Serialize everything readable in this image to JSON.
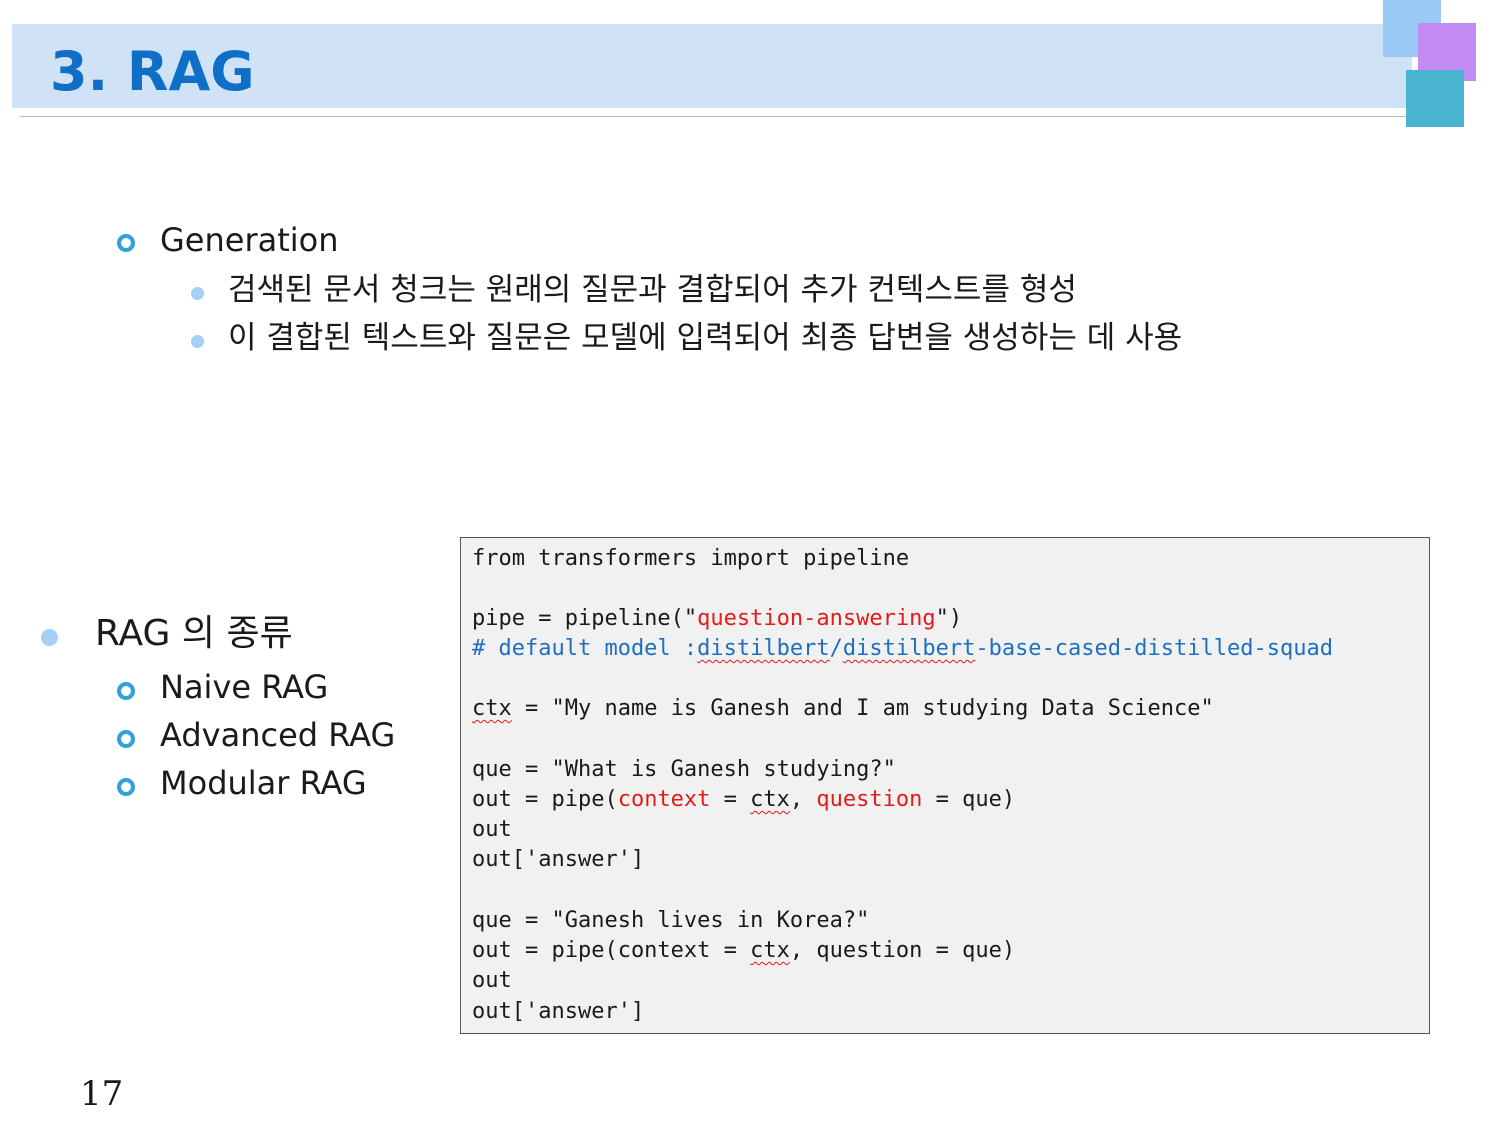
{
  "title": "3. RAG",
  "colors": {
    "accent": "#0f6fc6",
    "band": "#d0e2f5",
    "code_highlight_red": "#e31b1b",
    "code_comment_blue": "#1f6fc1"
  },
  "generation": {
    "heading": "Generation",
    "bullets": [
      "검색된 문서 청크는 원래의 질문과 결합되어 추가 컨텍스트를 형성",
      "이 결합된 텍스트와 질문은 모델에 입력되어 최종 답변을 생성하는 데 사용"
    ]
  },
  "rag_types": {
    "heading": "RAG 의 종류",
    "items": [
      "Naive RAG",
      "Advanced RAG",
      "Modular RAG"
    ]
  },
  "code": {
    "l1": "from transformers import pipeline",
    "l2_a": "pipe = pipeline(\"",
    "l2_b": "question-answering",
    "l2_c": "\")",
    "l3_a": "# default model :",
    "l3_b": "distilbert",
    "l3_c": "/",
    "l3_d": "distilbert",
    "l3_e": "-base-cased-distilled-squad",
    "l4_a": "ctx",
    "l4_b": " = \"My name is Ganesh and I am studying Data Science\"",
    "l5": "que = \"What is Ganesh studying?\"",
    "l6_a": "out = pipe(",
    "l6_b": "context",
    "l6_c": " = ",
    "l6_d": "ctx",
    "l6_e": ", ",
    "l6_f": "question",
    "l6_g": " = que)",
    "l7": "out",
    "l8": "out['answer']",
    "l9": "que = \"Ganesh lives in Korea?\"",
    "l10_a": "out = pipe(context = ",
    "l10_b": "ctx",
    "l10_c": ", question = que)",
    "l11": "out",
    "l12": "out['answer']"
  },
  "page_number": "17"
}
